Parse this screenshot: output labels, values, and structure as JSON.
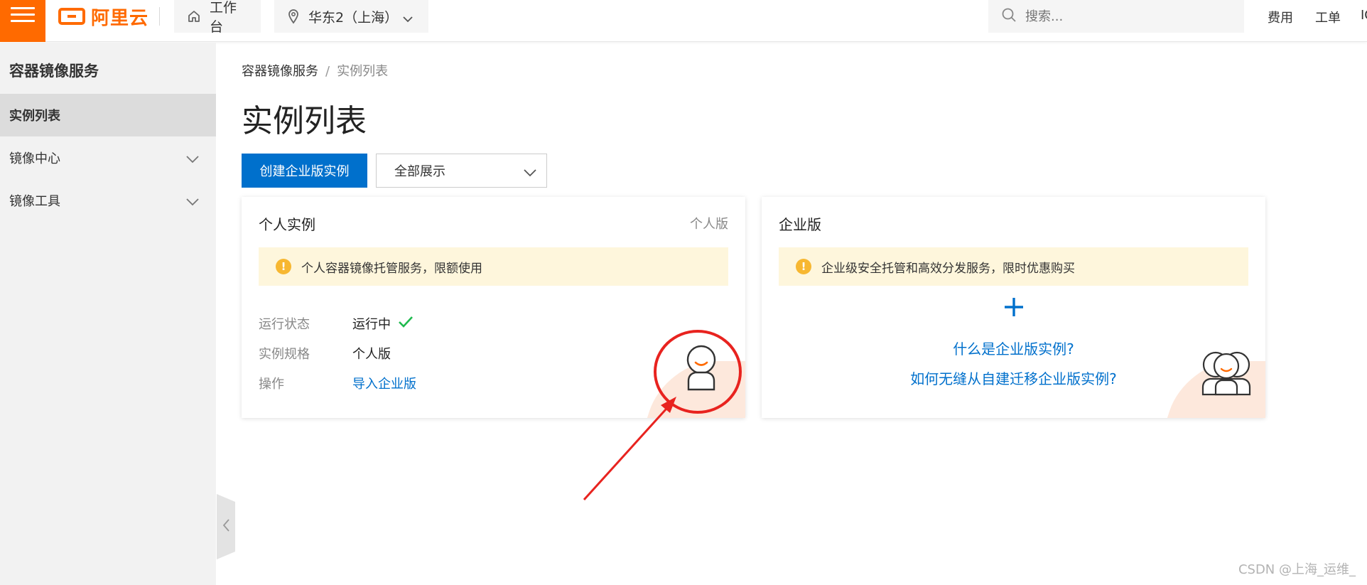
{
  "header": {
    "logo_text": "阿里云",
    "workbench_label": "工作台",
    "region_label": "华东2（上海）",
    "search_placeholder": "搜索...",
    "links": [
      "费用",
      "工单",
      "IC"
    ]
  },
  "sidebar": {
    "title": "容器镜像服务",
    "items": [
      {
        "label": "实例列表",
        "active": true,
        "expandable": false
      },
      {
        "label": "镜像中心",
        "active": false,
        "expandable": true
      },
      {
        "label": "镜像工具",
        "active": false,
        "expandable": true
      }
    ]
  },
  "breadcrumb": {
    "parent": "容器镜像服务",
    "separator": "/",
    "current": "实例列表"
  },
  "page": {
    "title": "实例列表",
    "create_button": "创建企业版实例",
    "filter_value": "全部展示"
  },
  "personal_card": {
    "title": "个人实例",
    "tag": "个人版",
    "notice": "个人容器镜像托管服务，限额使用",
    "rows": [
      {
        "key": "运行状态",
        "value": "运行中"
      },
      {
        "key": "实例规格",
        "value": "个人版"
      },
      {
        "key": "操作",
        "value": "导入企业版"
      }
    ]
  },
  "enterprise_card": {
    "title": "企业版",
    "notice": "企业级安全托管和高效分发服务，限时优惠购买",
    "link_what": "什么是企业版实例?",
    "link_migrate": "如何无缝从自建迁移企业版实例?"
  },
  "watermark": "CSDN @上海_运维_",
  "colors": {
    "brand_orange": "#ff6a00",
    "primary_blue": "#0070cc",
    "notice_bg": "#fef6dc",
    "warning_yellow": "#f7b731",
    "success_green": "#1fba4e",
    "annotation_red": "#e8231f"
  },
  "icons": [
    "menu-icon",
    "home-icon",
    "location-icon",
    "chevron-down-icon",
    "search-icon",
    "warning-icon",
    "check-icon",
    "plus-icon",
    "user-icon",
    "users-icon",
    "chevron-left-icon"
  ]
}
